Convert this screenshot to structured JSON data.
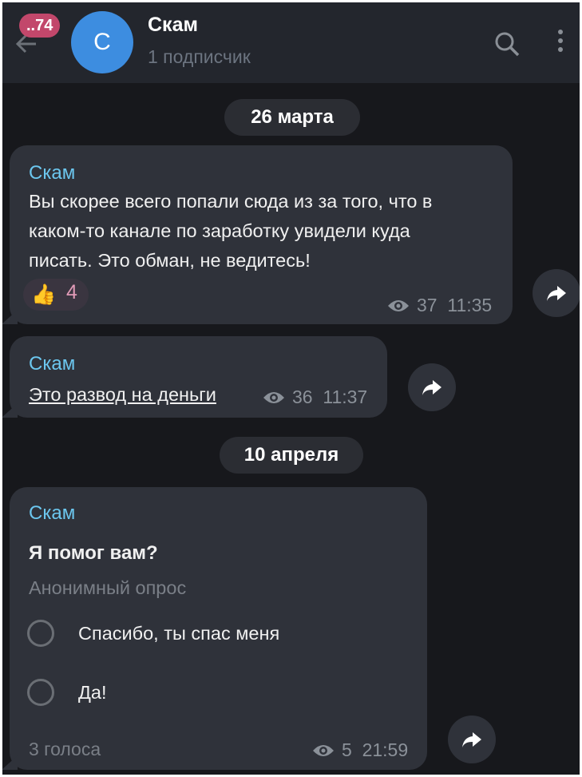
{
  "header": {
    "unread_count": "..74",
    "avatar_letter": "С",
    "title": "Скам",
    "subtitle": "1 подписчик"
  },
  "dates": [
    "26 марта",
    "10 апреля"
  ],
  "messages": [
    {
      "author": "Скам",
      "text_lines": [
        "Вы скорее всего попали сюда из за того, что в",
        "каком-то канале по заработку увидели куда",
        "писать. Это обман, не ведитесь!"
      ],
      "reaction_emoji": "👍",
      "reaction_count": "4",
      "views": "37",
      "time": "11:35"
    },
    {
      "author": "Скам",
      "link_text": "Это развод на деньги",
      "views": "36",
      "time": "11:37"
    },
    {
      "author": "Скам",
      "poll_question": "Я помог вам?",
      "poll_type": "Анонимный опрос",
      "options": [
        "Спасибо, ты спас меня",
        "Да!"
      ],
      "votes": "3 голоса",
      "views": "5",
      "time": "21:59"
    }
  ],
  "colors": {
    "background": "#17181c",
    "header": "#23262d",
    "bubble": "#2f323a",
    "author": "#6cc7ef",
    "avatar": "#3d8de0",
    "badge": "#c2476b"
  },
  "icons": [
    "back-arrow-icon",
    "search-icon",
    "more-vertical-icon",
    "eye-icon",
    "forward-icon",
    "radio-circle-icon"
  ]
}
